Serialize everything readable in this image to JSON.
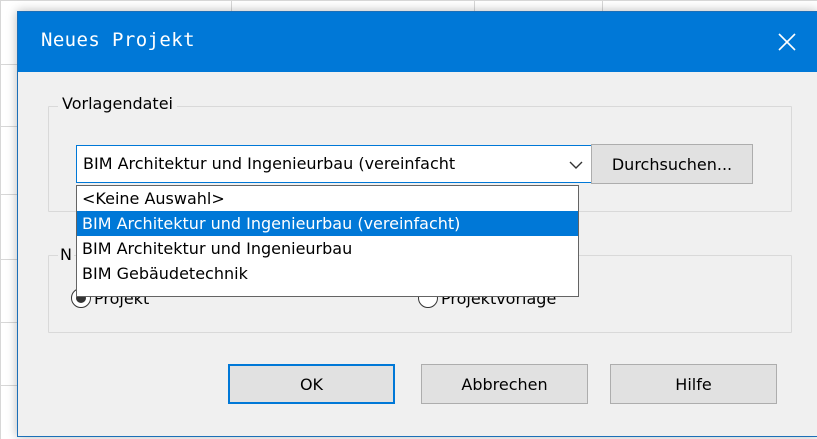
{
  "dialog": {
    "title": "Neues Projekt",
    "close_icon": "close-icon"
  },
  "template_group": {
    "label": "Vorlagendatei",
    "combo_value": "BIM Architektur und Ingenieurbau (vereinfacht",
    "browse_label": "Durchsuchen...",
    "dropdown_options": [
      "<Keine Auswahl>",
      "BIM Architektur und Ingenieurbau (vereinfacht)",
      "BIM Architektur und Ingenieurbau",
      "BIM Gebäudetechnik"
    ],
    "selected_index": 1
  },
  "new_group": {
    "label_visible": "N",
    "options": [
      {
        "label": "Projekt",
        "checked": true
      },
      {
        "label": "Projektvorlage",
        "checked": false
      }
    ]
  },
  "buttons": {
    "ok": "OK",
    "cancel": "Abbrechen",
    "help": "Hilfe"
  },
  "colors": {
    "accent": "#0078d7",
    "dialog_bg": "#f0f0f0",
    "button_bg": "#e1e1e1"
  }
}
